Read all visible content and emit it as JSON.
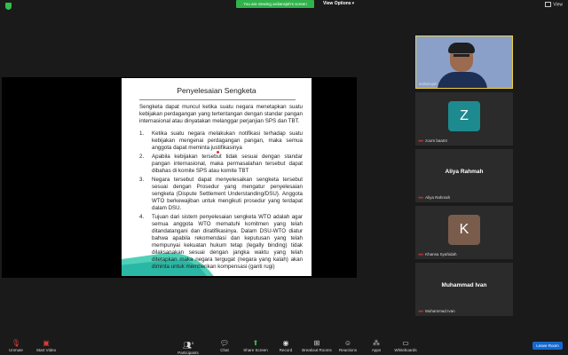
{
  "topbar": {
    "viewing_banner": "You are viewing ardiansjah's screen",
    "view_options_label": "View Options",
    "view_label": "View",
    "view_options_icon": "chevron-down-icon",
    "view_icon": "grid-icon"
  },
  "slide": {
    "title": "Penyelesaian Sengketa",
    "intro": "Sengketa dapat muncul ketika suatu negara menetapkan suatu kebijakan perdagangan yang tertentangan dengan standar pangan internasional atau dinyatakan melanggar perjanjian SPS dan TBT.",
    "points": [
      {
        "num": "1.",
        "text": "Ketika suatu negara melakukan notifikasi terhadap suatu kebijakan mengenai perdagangan pangan, maka semua anggota dapat meminta justifikasinya"
      },
      {
        "num": "2.",
        "text": "Apabila kebijakan tersebut tidak sesuai dengan standar pangan internasional, maka permasalahan tersebut dapat dibahas di komite SPS atau komite TBT"
      },
      {
        "num": "3.",
        "text": "Negara tersebut dapat menyelesaikan sengketa tersebut sesuai dengan Prosedur yang mengatur penyelesaian sengketa (Dispute Settlement Understanding/DSU). Anggota WTO berkewajiban untuk mengikuti prosedur yang terdapat dalam DSU."
      },
      {
        "num": "4.",
        "text": "Tujuan dari sistem penyelesaian sengketa WTO adalah agar semua anggota WTO mematuhi komitmen yang telah ditandatangani dan diratifikasinya. Dalam DSU-WTO diatur bahwa apabila rekomendasi dan keputusan yang telah mempunyai kekuatan hukum tetap (legally binding) tidak dilaksanakan sesuai dengan jangka waktu yang telah ditetapkan maka negara tergugat (negara yang kalah) akan diminta untuk memberikan kompensasi (ganti rugi)"
      }
    ]
  },
  "participants": [
    {
      "name": "ardiansjah",
      "type": "video",
      "muted": false
    },
    {
      "name": "zoom baa04",
      "type": "letter",
      "letter": "Z",
      "color": "#1c8a8f",
      "muted": true
    },
    {
      "name": "Aliya Rahmah",
      "type": "name",
      "big_name": "Aliya Rahmah",
      "muted": true
    },
    {
      "name": "Khansa Syahidah",
      "type": "letter",
      "letter": "K",
      "color": "#7a5c4c",
      "muted": true
    },
    {
      "name": "Muhammad Ivan",
      "type": "name",
      "big_name": "Muhammad Ivan",
      "muted": true
    }
  ],
  "toolbar": {
    "unmute": "Unmute",
    "start_video": "Start Video",
    "participants": "Participants",
    "participants_count": "5",
    "chat": "Chat",
    "share_screen": "Share Screen",
    "record": "Record",
    "breakout_rooms": "Breakout Rooms",
    "reactions": "Reactions",
    "apps": "Apps",
    "whiteboards": "Whiteboards",
    "leave": "Leave Room"
  }
}
